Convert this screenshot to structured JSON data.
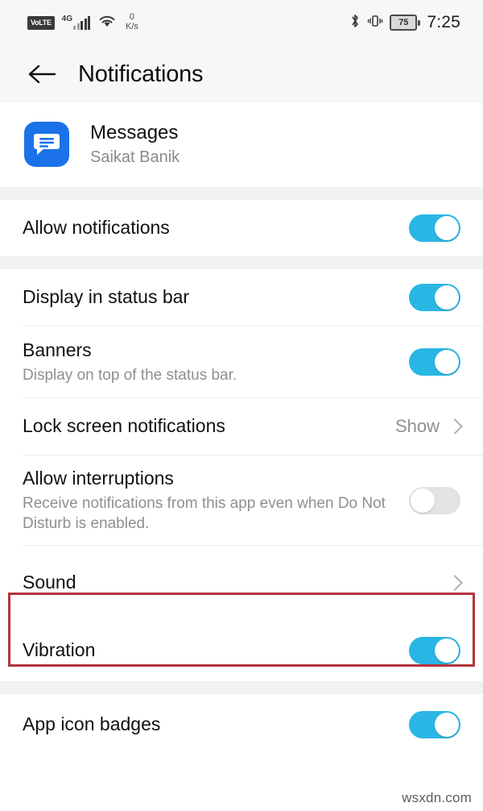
{
  "status_bar": {
    "volte_label": "VoLTE",
    "network_label": "4G",
    "data_speed_value": "0",
    "data_speed_unit": "K/s",
    "battery_level": "75",
    "time": "7:25",
    "icons": [
      "volte-badge",
      "signal-bars-icon",
      "wifi-icon",
      "bluetooth-icon",
      "vibrate-icon",
      "battery-icon"
    ]
  },
  "header": {
    "title": "Notifications",
    "back_icon": "back-arrow-icon"
  },
  "app": {
    "name": "Messages",
    "account": "Saikat Banik",
    "icon": "messages-app-icon",
    "icon_color": "#1b72e8"
  },
  "colors": {
    "toggle_on": "#29b6e5",
    "toggle_off": "#e3e3e3",
    "highlight": "#b3353b",
    "section_gap": "#f2f2f2"
  },
  "sections": [
    {
      "rows": [
        {
          "label": "Allow notifications",
          "type": "toggle",
          "state": "on"
        }
      ]
    },
    {
      "rows": [
        {
          "label": "Display in status bar",
          "type": "toggle",
          "state": "on"
        },
        {
          "label": "Banners",
          "sublabel": "Display on top of the status bar.",
          "type": "toggle",
          "state": "on"
        },
        {
          "label": "Lock screen notifications",
          "type": "value",
          "value": "Show"
        },
        {
          "label": "Allow interruptions",
          "sublabel": "Receive notifications from this app even when Do Not Disturb is enabled.",
          "type": "toggle",
          "state": "off"
        },
        {
          "label": "Sound",
          "type": "chevron",
          "highlighted": true
        },
        {
          "label": "Vibration",
          "type": "toggle",
          "state": "on"
        }
      ]
    },
    {
      "rows": [
        {
          "label": "App icon badges",
          "type": "toggle",
          "state": "on"
        }
      ]
    }
  ],
  "watermark": "wsxdn.com"
}
